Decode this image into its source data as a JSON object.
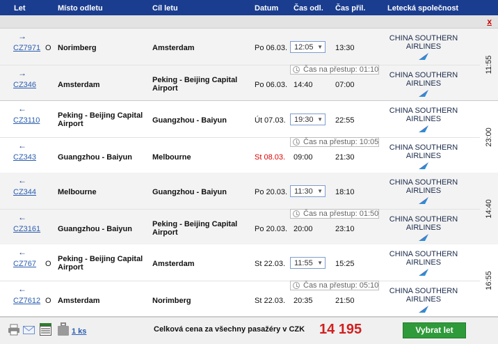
{
  "header": {
    "flight": "Let",
    "from": "Místo odletu",
    "to": "Cíl letu",
    "date": "Datum",
    "dep": "Čas odl.",
    "arr": "Čas přil.",
    "airline": "Letecká společnost"
  },
  "close_label": "x",
  "trips": [
    {
      "duration": "11:55",
      "transfer": "Čas na přestup: 01:10",
      "legs": [
        {
          "direction": "→",
          "flight": "CZ7971",
          "mark": "O",
          "from": "Norimberg",
          "to": "Amsterdam",
          "date": "Po 06.03.",
          "dep": "12:05",
          "arr": "13:30",
          "airline": "CHINA SOUTHERN AIRLINES"
        },
        {
          "direction": "→",
          "flight": "CZ346",
          "mark": "",
          "from": "Amsterdam",
          "to": "Peking - Beijing Capital Airport",
          "date": "Po 06.03.",
          "dep": "14:40",
          "arr": "07:00",
          "airline": "CHINA SOUTHERN AIRLINES"
        }
      ]
    },
    {
      "duration": "23:00",
      "transfer": "Čas na přestup: 10:05",
      "legs": [
        {
          "direction": "←",
          "flight": "CZ3110",
          "mark": "",
          "from": "Peking - Beijing Capital Airport",
          "to": "Guangzhou - Baiyun",
          "date": "Út 07.03.",
          "dep": "19:30",
          "arr": "22:55",
          "airline": "CHINA SOUTHERN AIRLINES"
        },
        {
          "direction": "←",
          "flight": "CZ343",
          "mark": "",
          "from": "Guangzhou - Baiyun",
          "to": "Melbourne",
          "date": "St 08.03.",
          "dep": "09:00",
          "arr": "21:30",
          "airline": "CHINA SOUTHERN AIRLINES"
        }
      ]
    },
    {
      "duration": "14:40",
      "transfer": "Čas na přestup: 01:50",
      "legs": [
        {
          "direction": "←",
          "flight": "CZ344",
          "mark": "",
          "from": "Melbourne",
          "to": "Guangzhou - Baiyun",
          "date": "Po 20.03.",
          "dep": "11:30",
          "arr": "18:10",
          "airline": "CHINA SOUTHERN AIRLINES"
        },
        {
          "direction": "←",
          "flight": "CZ3161",
          "mark": "",
          "from": "Guangzhou - Baiyun",
          "to": "Peking - Beijing Capital Airport",
          "date": "Po 20.03.",
          "dep": "20:00",
          "arr": "23:10",
          "airline": "CHINA SOUTHERN AIRLINES"
        }
      ]
    },
    {
      "duration": "16:55",
      "transfer": "Čas na přestup: 05:10",
      "legs": [
        {
          "direction": "←",
          "flight": "CZ767",
          "mark": "O",
          "from": "Peking - Beijing Capital Airport",
          "to": "Amsterdam",
          "date": "St 22.03.",
          "dep": "11:55",
          "arr": "15:25",
          "airline": "CHINA SOUTHERN AIRLINES"
        },
        {
          "direction": "←",
          "flight": "CZ7612",
          "mark": "O",
          "from": "Amsterdam",
          "to": "Norimberg",
          "date": "St 22.03.",
          "dep": "20:35",
          "arr": "21:50",
          "airline": "CHINA SOUTHERN AIRLINES"
        }
      ]
    }
  ],
  "footer": {
    "bag_count": "1 ks",
    "total_label": "Celková cena za všechny pasažéry v CZK",
    "total_price": "14 195",
    "select_button": "Vybrat let"
  },
  "colors": {
    "header_bg": "#1a3d8f",
    "price": "#d0201f",
    "select_button": "#2f9a3a",
    "red_date": "#d00000"
  },
  "icons": [
    "print-icon",
    "email-icon",
    "details-icon",
    "baggage-icon",
    "plane-arrow-icon",
    "china-southern-logo-icon",
    "clock-icon"
  ]
}
